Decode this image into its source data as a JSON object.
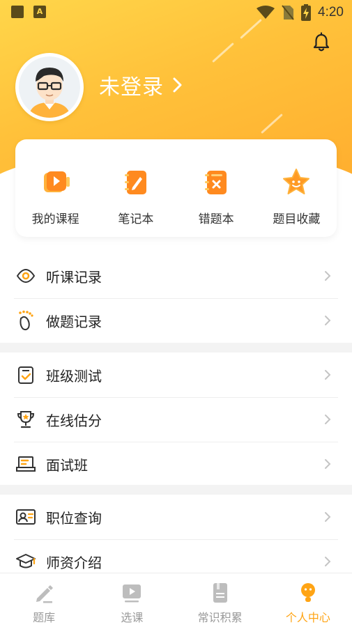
{
  "status_bar": {
    "time": "4:20"
  },
  "profile": {
    "login_text": "未登录"
  },
  "quick_actions": [
    {
      "label": "我的课程",
      "icon": "video-course-icon"
    },
    {
      "label": "笔记本",
      "icon": "notebook-pen-icon"
    },
    {
      "label": "错题本",
      "icon": "wrong-question-book-icon"
    },
    {
      "label": "题目收藏",
      "icon": "star-favorite-icon"
    }
  ],
  "menu_groups": [
    [
      {
        "label": "听课记录",
        "icon": "eye-icon"
      },
      {
        "label": "做题记录",
        "icon": "footprint-icon"
      }
    ],
    [
      {
        "label": "班级测试",
        "icon": "checklist-icon"
      },
      {
        "label": "在线估分",
        "icon": "trophy-icon"
      },
      {
        "label": "面试班",
        "icon": "laptop-icon"
      }
    ],
    [
      {
        "label": "职位查询",
        "icon": "id-card-icon"
      },
      {
        "label": "师资介绍",
        "icon": "graduation-cap-icon"
      }
    ]
  ],
  "tabs": [
    {
      "label": "题库",
      "icon": "pencil-icon",
      "active": false
    },
    {
      "label": "选课",
      "icon": "play-video-icon",
      "active": false
    },
    {
      "label": "常识积累",
      "icon": "document-icon",
      "active": false
    },
    {
      "label": "个人中心",
      "icon": "person-icon",
      "active": true
    }
  ],
  "colors": {
    "accent": "#ffa414",
    "header_start": "#ffd64a",
    "header_end": "#ffae2f"
  }
}
